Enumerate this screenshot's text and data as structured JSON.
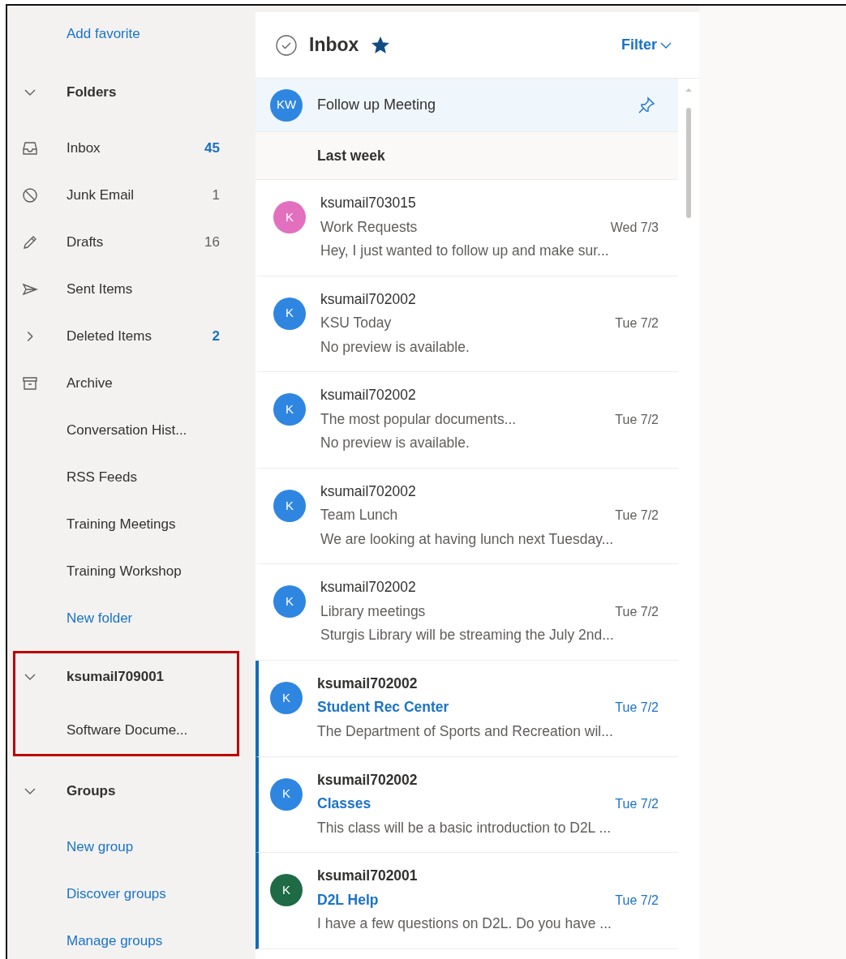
{
  "sidebar": {
    "add_favorite": "Add favorite",
    "sections": [
      {
        "title": "Folders",
        "expanded": true,
        "highlighted": false,
        "items": [
          {
            "label": "Inbox",
            "kind": "inbox",
            "count": "45",
            "unread": true
          },
          {
            "label": "Junk Email",
            "kind": "junk",
            "count": "1",
            "unread": false
          },
          {
            "label": "Drafts",
            "kind": "drafts",
            "count": "16",
            "unread": false
          },
          {
            "label": "Sent Items",
            "kind": "sent"
          },
          {
            "label": "Deleted Items",
            "kind": "expander",
            "count": "2",
            "unread": true
          },
          {
            "label": "Archive",
            "kind": "archive"
          },
          {
            "label": "Conversation Hist...",
            "kind": "folder"
          },
          {
            "label": "RSS Feeds",
            "kind": "folder"
          },
          {
            "label": "Training Meetings",
            "kind": "folder"
          },
          {
            "label": "Training Workshop",
            "kind": "folder"
          },
          {
            "label": "New folder",
            "kind": "link"
          }
        ]
      },
      {
        "title": "ksumail709001",
        "expanded": true,
        "highlighted": true,
        "items": [
          {
            "label": "Software Docume...",
            "kind": "folder"
          }
        ]
      },
      {
        "title": "Groups",
        "expanded": true,
        "highlighted": false,
        "items": [
          {
            "label": "New group",
            "kind": "link"
          },
          {
            "label": "Discover groups",
            "kind": "link"
          },
          {
            "label": "Manage groups",
            "kind": "link"
          }
        ]
      }
    ]
  },
  "message_list": {
    "title": "Inbox",
    "favorite": true,
    "filter": "Filter",
    "pinned": {
      "initials": "KW",
      "color": "#2f86e0",
      "subject": "Follow up Meeting",
      "pinned": true
    },
    "group_label": "Last week",
    "messages": [
      {
        "initials": "K",
        "color": "#e36fbf",
        "sender": "ksumail703015",
        "subject": "Work Requests",
        "date": "Wed 7/3",
        "preview": "Hey, I just wanted to follow up and make sur...",
        "unread": false
      },
      {
        "initials": "K",
        "color": "#2f86e0",
        "sender": "ksumail702002",
        "subject": "KSU Today",
        "date": "Tue 7/2",
        "preview": "No preview is available.",
        "unread": false
      },
      {
        "initials": "K",
        "color": "#2f86e0",
        "sender": "ksumail702002",
        "subject": "The most popular documents...",
        "date": "Tue 7/2",
        "preview": "No preview is available.",
        "unread": false
      },
      {
        "initials": "K",
        "color": "#2f86e0",
        "sender": "ksumail702002",
        "subject": "Team Lunch",
        "date": "Tue 7/2",
        "preview": "We are looking at having lunch next Tuesday...",
        "unread": false
      },
      {
        "initials": "K",
        "color": "#2f86e0",
        "sender": "ksumail702002",
        "subject": "Library meetings",
        "date": "Tue 7/2",
        "preview": "Sturgis Library will be streaming the July 2nd...",
        "unread": false
      },
      {
        "initials": "K",
        "color": "#2f86e0",
        "sender": "ksumail702002",
        "subject": "Student Rec Center",
        "date": "Tue 7/2",
        "preview": "The Department of Sports and Recreation wil...",
        "unread": true
      },
      {
        "initials": "K",
        "color": "#2f86e0",
        "sender": "ksumail702002",
        "subject": "Classes",
        "date": "Tue 7/2",
        "preview": "This class will be a basic introduction to D2L ...",
        "unread": true
      },
      {
        "initials": "K",
        "color": "#1e6b45",
        "sender": "ksumail702001",
        "subject": "D2L Help",
        "date": "Tue 7/2",
        "preview": "I have a few questions on D2L. Do you have ...",
        "unread": true
      }
    ]
  }
}
